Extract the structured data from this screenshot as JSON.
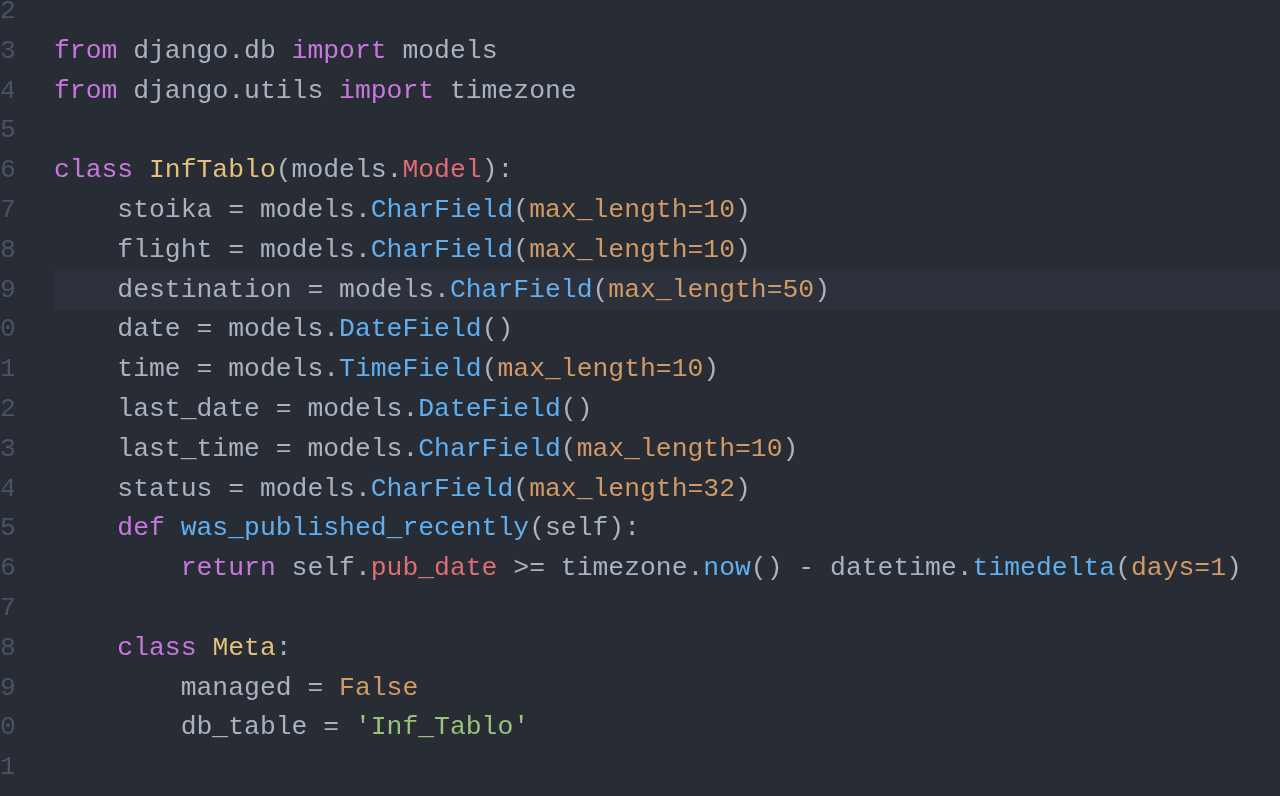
{
  "editor": {
    "lines": [
      {
        "number": "2",
        "current": false
      },
      {
        "number": "3",
        "current": false,
        "tokens": [
          {
            "kind": "keyword",
            "text": "from"
          },
          {
            "kind": "plain",
            "text": " django.db "
          },
          {
            "kind": "keyword",
            "text": "import"
          },
          {
            "kind": "plain",
            "text": " models"
          }
        ]
      },
      {
        "number": "4",
        "current": false,
        "tokens": [
          {
            "kind": "keyword",
            "text": "from"
          },
          {
            "kind": "plain",
            "text": " django.utils "
          },
          {
            "kind": "keyword",
            "text": "import"
          },
          {
            "kind": "plain",
            "text": " timezone"
          }
        ]
      },
      {
        "number": "5",
        "current": false
      },
      {
        "number": "6",
        "current": false,
        "tokens": [
          {
            "kind": "keyword",
            "text": "class"
          },
          {
            "kind": "type",
            "text": " InfTablo"
          },
          {
            "kind": "plain",
            "text": "(models."
          },
          {
            "kind": "variable",
            "text": "Model"
          },
          {
            "kind": "plain",
            "text": "):"
          }
        ]
      },
      {
        "number": "7",
        "current": false,
        "tokens": [
          {
            "kind": "plain",
            "text": "    stoika = models."
          },
          {
            "kind": "function",
            "text": "CharField"
          },
          {
            "kind": "plain",
            "text": "("
          },
          {
            "kind": "param",
            "text": "max_length=10"
          },
          {
            "kind": "plain",
            "text": ")"
          }
        ]
      },
      {
        "number": "8",
        "current": false,
        "tokens": [
          {
            "kind": "plain",
            "text": "    flight = models."
          },
          {
            "kind": "function",
            "text": "CharField"
          },
          {
            "kind": "plain",
            "text": "("
          },
          {
            "kind": "param",
            "text": "max_length=10"
          },
          {
            "kind": "plain",
            "text": ")"
          }
        ]
      },
      {
        "number": "9",
        "current": true,
        "tokens": [
          {
            "kind": "plain",
            "text": "    destination = models."
          },
          {
            "kind": "function",
            "text": "CharField"
          },
          {
            "kind": "plain",
            "text": "("
          },
          {
            "kind": "param",
            "text": "max_length=50"
          },
          {
            "kind": "plain",
            "text": ")"
          }
        ]
      },
      {
        "number": "0",
        "current": false,
        "tokens": [
          {
            "kind": "plain",
            "text": "    date = models."
          },
          {
            "kind": "function",
            "text": "DateField"
          },
          {
            "kind": "plain",
            "text": "()"
          }
        ]
      },
      {
        "number": "1",
        "current": false,
        "tokens": [
          {
            "kind": "plain",
            "text": "    time = models."
          },
          {
            "kind": "function",
            "text": "TimeField"
          },
          {
            "kind": "plain",
            "text": "("
          },
          {
            "kind": "param",
            "text": "max_length=10"
          },
          {
            "kind": "plain",
            "text": ")"
          }
        ]
      },
      {
        "number": "2",
        "current": false,
        "tokens": [
          {
            "kind": "plain",
            "text": "    last_date = models."
          },
          {
            "kind": "function",
            "text": "DateField"
          },
          {
            "kind": "plain",
            "text": "()"
          }
        ]
      },
      {
        "number": "3",
        "current": false,
        "tokens": [
          {
            "kind": "plain",
            "text": "    last_time = models."
          },
          {
            "kind": "function",
            "text": "CharField"
          },
          {
            "kind": "plain",
            "text": "("
          },
          {
            "kind": "param",
            "text": "max_length=10"
          },
          {
            "kind": "plain",
            "text": ")"
          }
        ]
      },
      {
        "number": "4",
        "current": false,
        "tokens": [
          {
            "kind": "plain",
            "text": "    status = models."
          },
          {
            "kind": "function",
            "text": "CharField"
          },
          {
            "kind": "plain",
            "text": "("
          },
          {
            "kind": "param",
            "text": "max_length=32"
          },
          {
            "kind": "plain",
            "text": ")"
          }
        ]
      },
      {
        "number": "5",
        "current": false,
        "tokens": [
          {
            "kind": "keyword",
            "text": "    def"
          },
          {
            "kind": "function",
            "text": " was_published_recently"
          },
          {
            "kind": "plain",
            "text": "(self):"
          }
        ]
      },
      {
        "number": "6",
        "current": false,
        "tokens": [
          {
            "kind": "keyword",
            "text": "        return"
          },
          {
            "kind": "plain",
            "text": " self."
          },
          {
            "kind": "variable",
            "text": "pub_date"
          },
          {
            "kind": "plain",
            "text": " >= timezone."
          },
          {
            "kind": "function",
            "text": "now"
          },
          {
            "kind": "plain",
            "text": "() - datetime."
          },
          {
            "kind": "function",
            "text": "timedelta"
          },
          {
            "kind": "plain",
            "text": "("
          },
          {
            "kind": "param",
            "text": "days=1"
          },
          {
            "kind": "plain",
            "text": ")"
          }
        ]
      },
      {
        "number": "7",
        "current": false
      },
      {
        "number": "8",
        "current": false,
        "tokens": [
          {
            "kind": "keyword",
            "text": "    class"
          },
          {
            "kind": "type",
            "text": " Meta"
          },
          {
            "kind": "plain",
            "text": ":"
          }
        ]
      },
      {
        "number": "9",
        "current": false,
        "tokens": [
          {
            "kind": "plain",
            "text": "        managed = "
          },
          {
            "kind": "param",
            "text": "False"
          }
        ]
      },
      {
        "number": "0",
        "current": false,
        "tokens": [
          {
            "kind": "plain",
            "text": "        db_table = "
          },
          {
            "kind": "string",
            "text": "'Inf_Tablo'"
          }
        ]
      },
      {
        "number": "1",
        "current": false
      }
    ]
  }
}
